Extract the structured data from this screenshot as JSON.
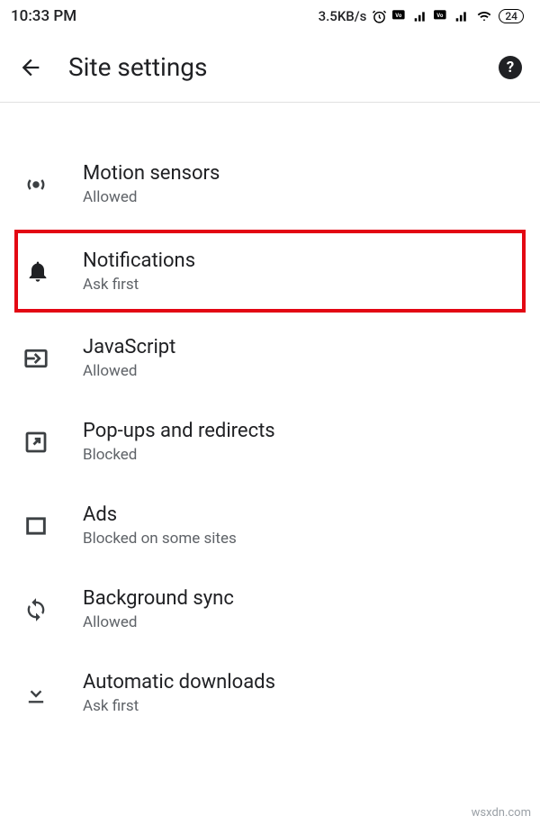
{
  "status": {
    "time": "10:33 PM",
    "net_speed": "3.5KB/s",
    "battery": "24"
  },
  "header": {
    "title": "Site settings"
  },
  "rows": {
    "cut": {
      "sub": ""
    },
    "motion": {
      "title": "Motion sensors",
      "sub": "Allowed"
    },
    "notifications": {
      "title": "Notifications",
      "sub": "Ask first"
    },
    "javascript": {
      "title": "JavaScript",
      "sub": "Allowed"
    },
    "popups": {
      "title": "Pop-ups and redirects",
      "sub": "Blocked"
    },
    "ads": {
      "title": "Ads",
      "sub": "Blocked on some sites"
    },
    "sync": {
      "title": "Background sync",
      "sub": "Allowed"
    },
    "downloads": {
      "title": "Automatic downloads",
      "sub": "Ask first"
    }
  },
  "watermark": "wsxdn.com"
}
